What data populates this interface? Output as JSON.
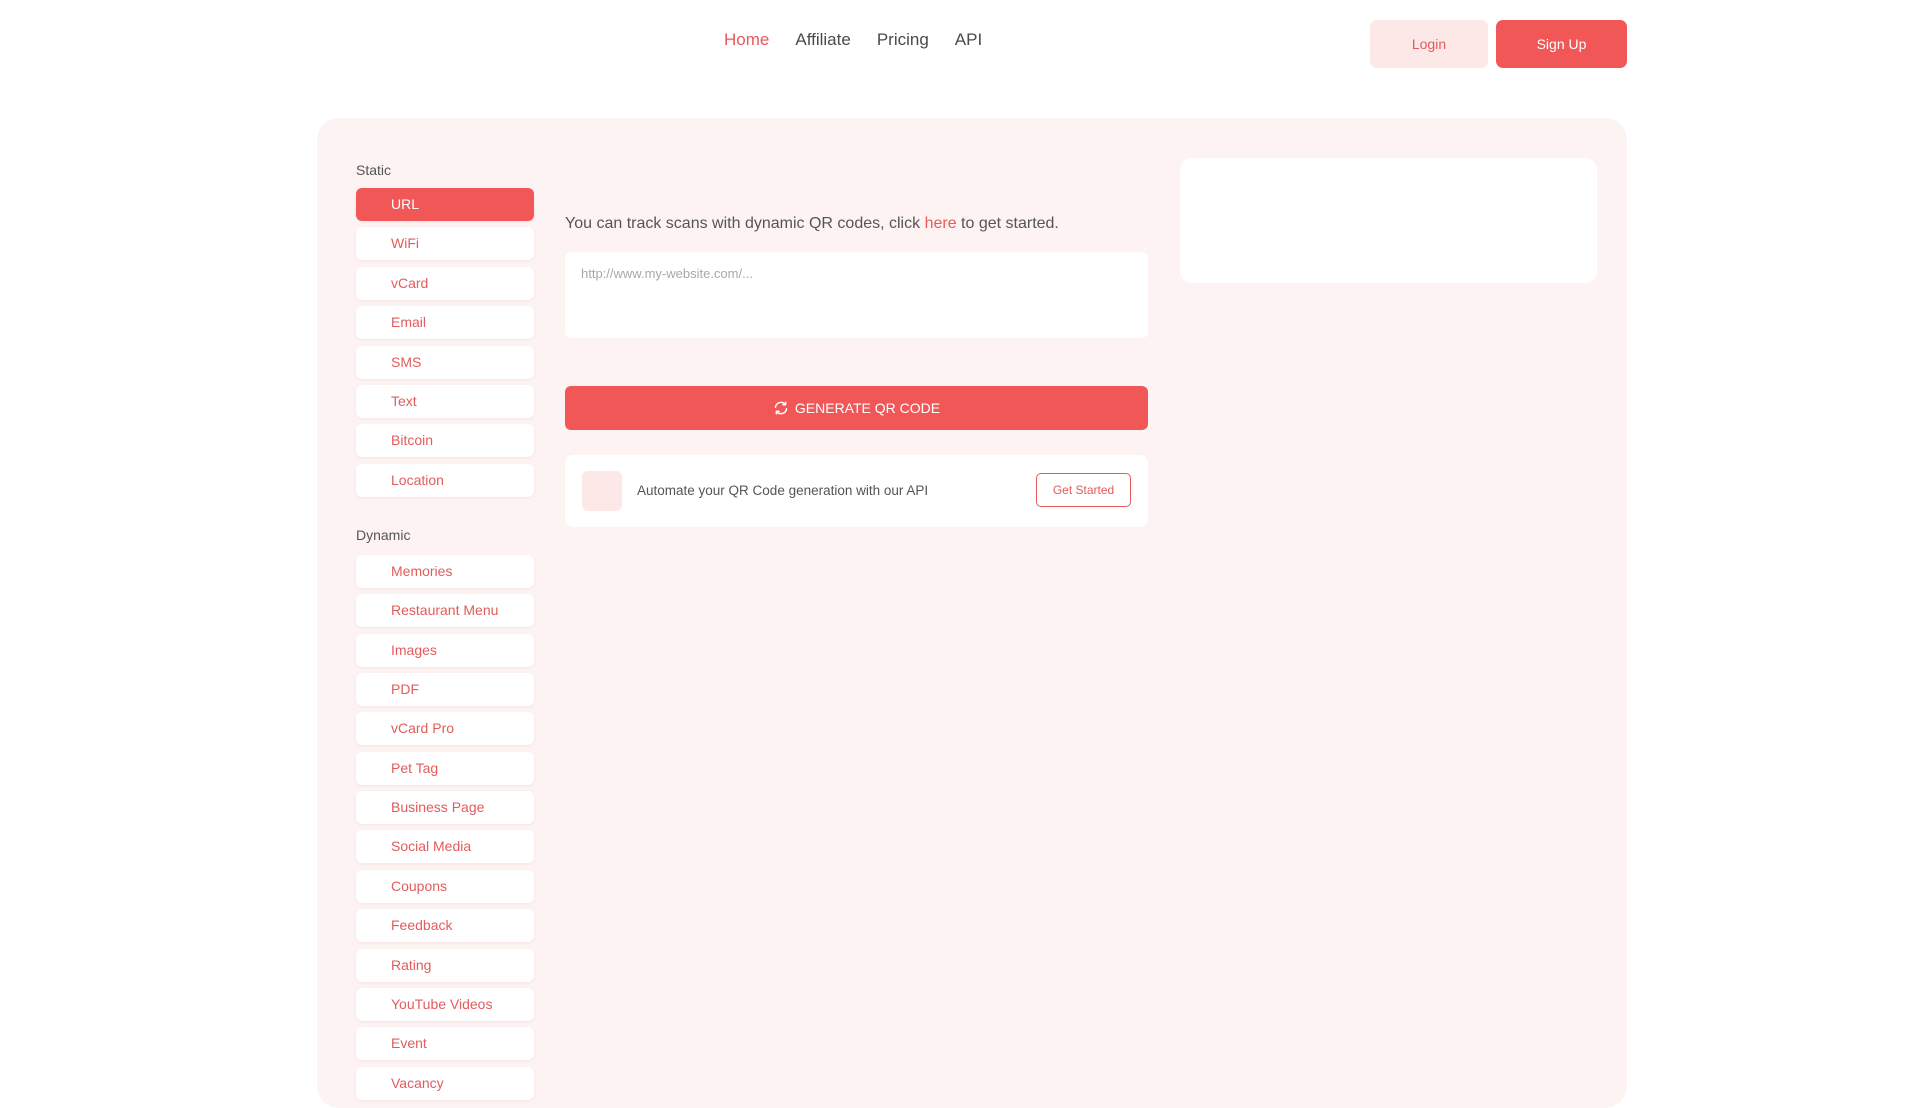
{
  "nav": {
    "items": [
      {
        "label": "Home",
        "active": true
      },
      {
        "label": "Affiliate",
        "active": false
      },
      {
        "label": "Pricing",
        "active": false
      },
      {
        "label": "API",
        "active": false
      }
    ],
    "login_label": "Login",
    "signup_label": "Sign Up"
  },
  "sidebar": {
    "static_label": "Static",
    "static_items": [
      "URL",
      "WiFi",
      "vCard",
      "Email",
      "SMS",
      "Text",
      "Bitcoin",
      "Location"
    ],
    "active_item": "URL",
    "dynamic_label": "Dynamic",
    "dynamic_items": [
      "Memories",
      "Restaurant Menu",
      "Images",
      "PDF",
      "vCard Pro",
      "Pet Tag",
      "Business Page",
      "Social Media",
      "Coupons",
      "Feedback",
      "Rating",
      "YouTube Videos",
      "Event",
      "Vacancy"
    ]
  },
  "main": {
    "info_prefix": "You can track scans with dynamic QR codes, click ",
    "info_link": "here",
    "info_suffix": " to get started.",
    "url_placeholder": "http://www.my-website.com/...",
    "url_value": "",
    "generate_label": "GENERATE QR CODE",
    "generate_icon": "refresh-icon",
    "api_text": "Automate your QR Code generation with our API",
    "api_button_label": "Get Started"
  },
  "colors": {
    "accent": "#f15757",
    "accent_light": "#fde8e8",
    "panel_bg": "#fdf3f3"
  }
}
